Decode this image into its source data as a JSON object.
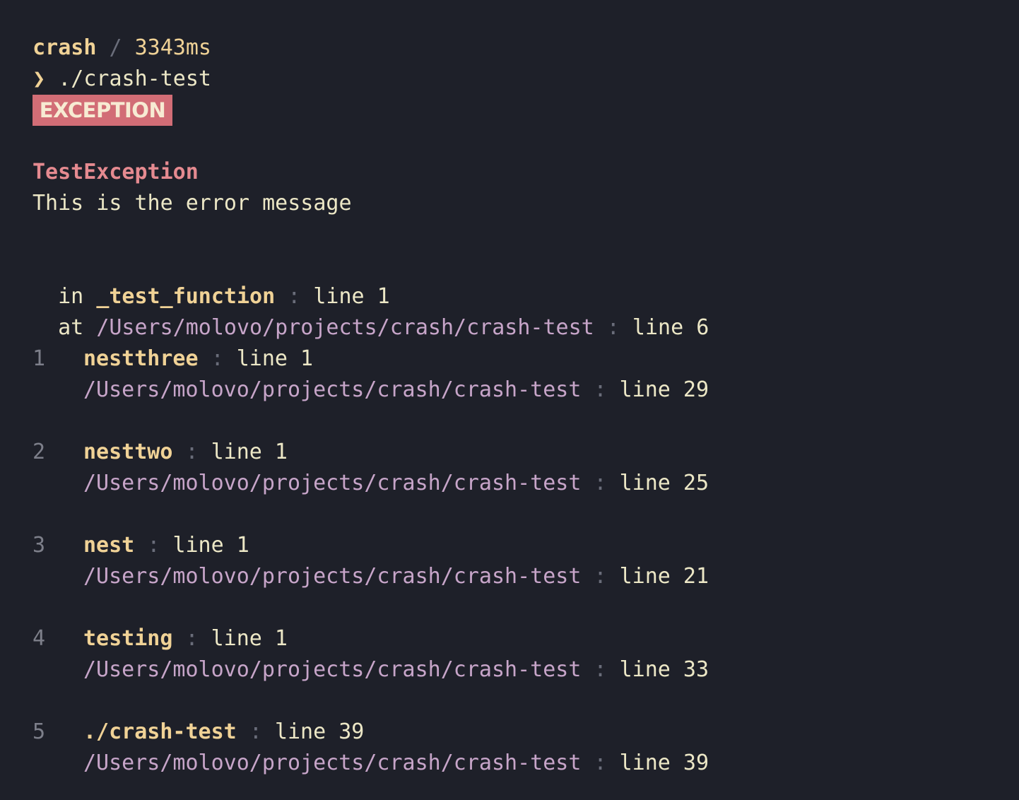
{
  "header": {
    "app": "crash",
    "separator": "/",
    "duration": "3343ms"
  },
  "prompt": {
    "arrow": "❯",
    "command": "./crash-test"
  },
  "badge": {
    "label": "EXCEPTION"
  },
  "exception": {
    "name": "TestException",
    "message": "This is the error message"
  },
  "origin": {
    "in_label": "in",
    "function": "_test_function",
    "function_line": "line 1",
    "at_label": "at",
    "file": "/Users/molovo/projects/crash/crash-test",
    "file_line": "line 6",
    "colon": ":"
  },
  "frames": [
    {
      "index": "1",
      "function": "nestthree",
      "function_line": "line 1",
      "file": "/Users/molovo/projects/crash/crash-test",
      "file_line": "line 29"
    },
    {
      "index": "2",
      "function": "nesttwo",
      "function_line": "line 1",
      "file": "/Users/molovo/projects/crash/crash-test",
      "file_line": "line 25"
    },
    {
      "index": "3",
      "function": "nest",
      "function_line": "line 1",
      "file": "/Users/molovo/projects/crash/crash-test",
      "file_line": "line 21"
    },
    {
      "index": "4",
      "function": "testing",
      "function_line": "line 1",
      "file": "/Users/molovo/projects/crash/crash-test",
      "file_line": "line 33"
    },
    {
      "index": "5",
      "function": "./crash-test",
      "function_line": "line 39",
      "file": "/Users/molovo/projects/crash/crash-test",
      "file_line": "line 39"
    }
  ],
  "colors": {
    "background": "#1e2029",
    "text": "#ece7c6",
    "function": "#f0d296",
    "path": "#c7a5c9",
    "exception": "#e58a90",
    "badge": "#d26d76"
  }
}
